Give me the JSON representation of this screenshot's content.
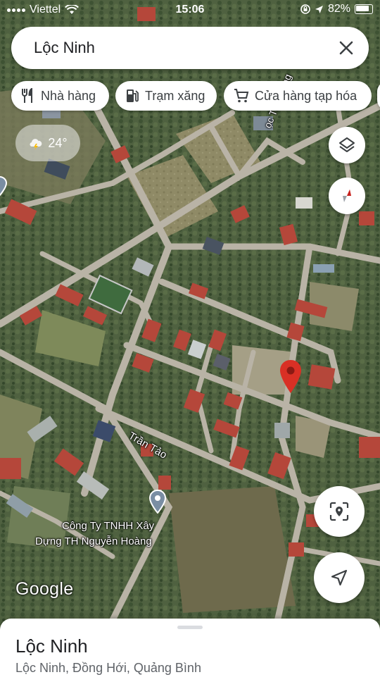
{
  "status_bar": {
    "carrier": "Viettel",
    "time": "15:06",
    "battery": "82%"
  },
  "search": {
    "query": "Lộc Ninh",
    "close_icon": "close-icon"
  },
  "chips": [
    {
      "label": "Nhà hàng",
      "icon": "restaurant-icon"
    },
    {
      "label": "Trạm xăng",
      "icon": "gas-station-icon"
    },
    {
      "label": "Cửa hàng tạp hóa",
      "icon": "shopping-cart-icon"
    }
  ],
  "weather": {
    "temperature": "24°",
    "icon": "thunderstorm-icon"
  },
  "map": {
    "type": "satellite",
    "street_labels": [
      {
        "text": "ọc Thái Tông"
      },
      {
        "text": "Trần Tảo"
      }
    ],
    "poi": {
      "name_line1": "Công Ty TNHH Xây",
      "name_line2": "Dựng TH Nguyễn Hoàng"
    },
    "attribution": "Google",
    "pin_color": "#d93025"
  },
  "place_sheet": {
    "title": "Lộc Ninh",
    "subtitle": "Lộc Ninh, Đồng Hới, Quảng Bình"
  }
}
